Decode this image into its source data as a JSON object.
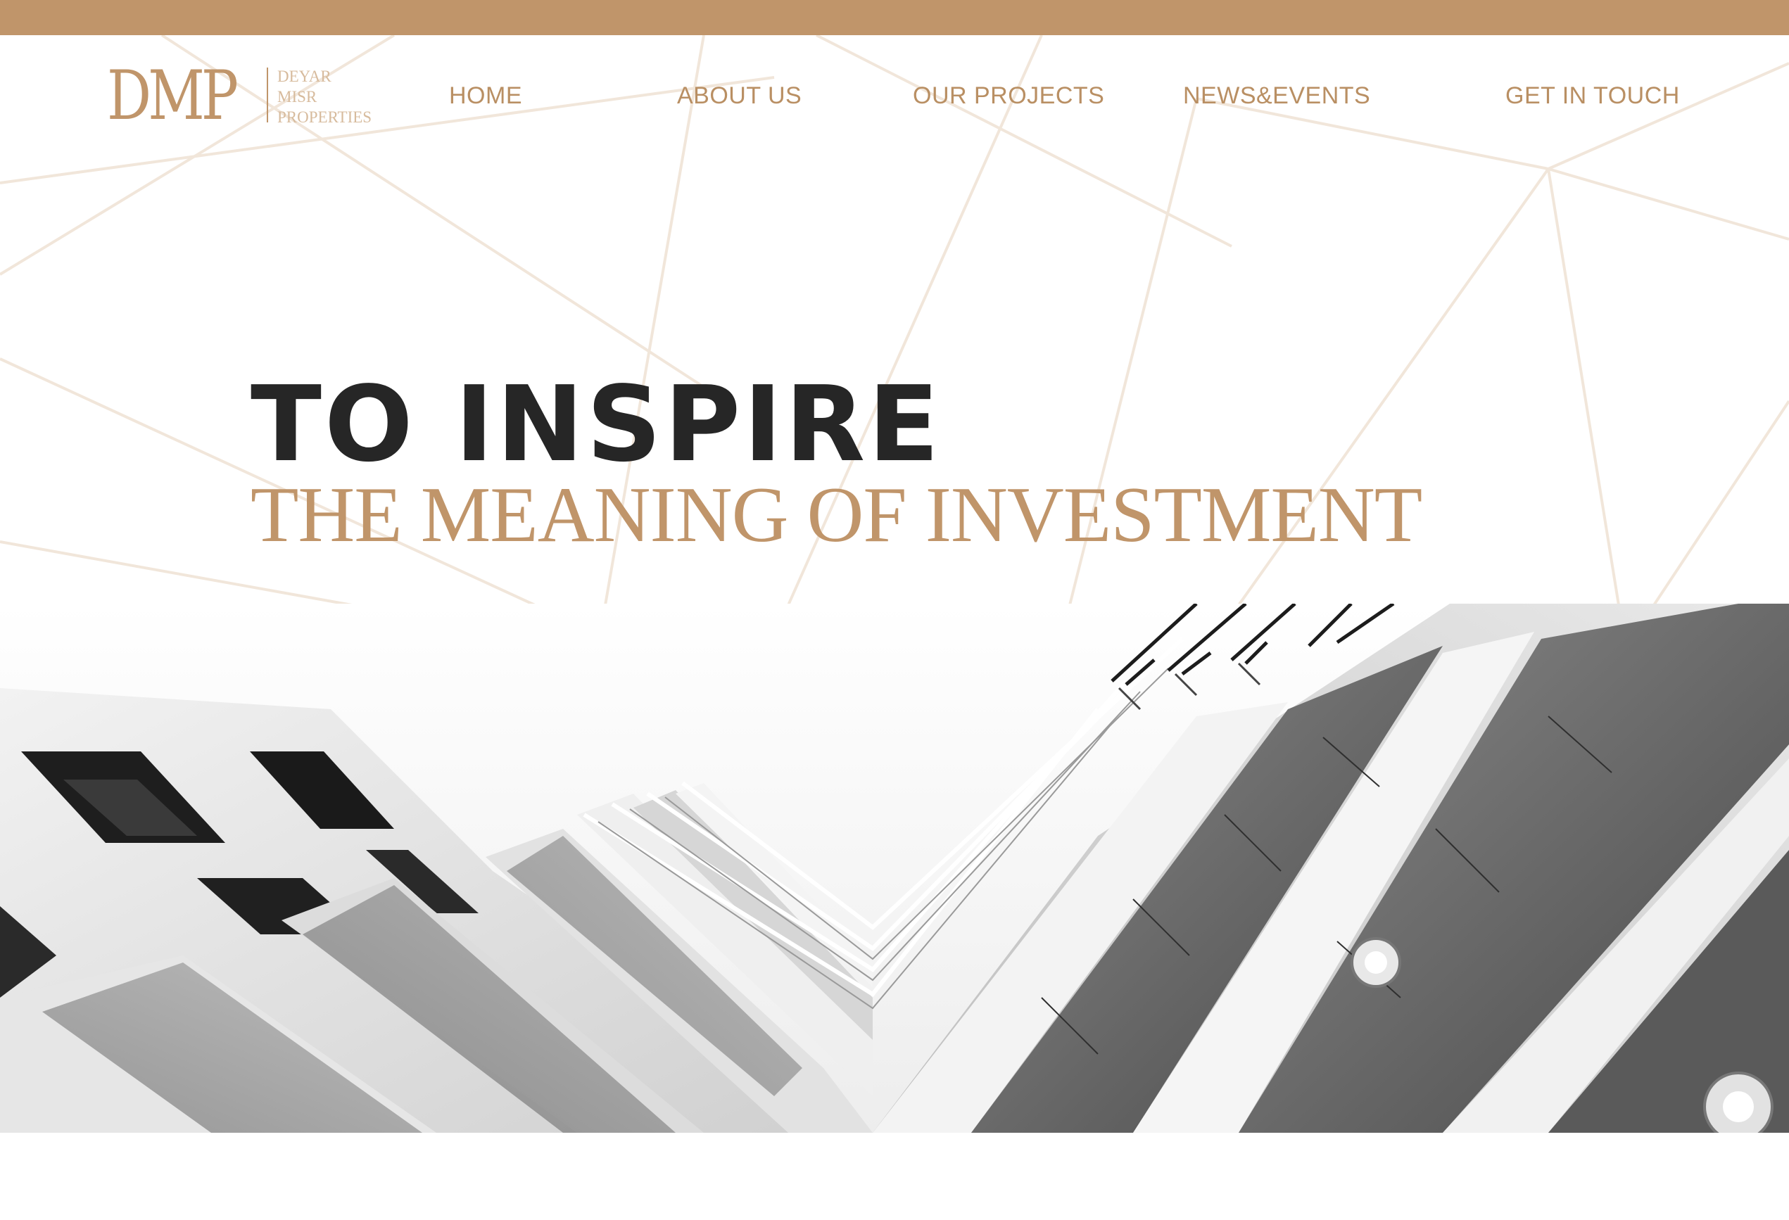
{
  "brand": {
    "mark": "DMP",
    "words": [
      "DEYAR",
      "MISR",
      "PROPERTIES"
    ],
    "accent_color": "#c0956a"
  },
  "nav": {
    "items": [
      {
        "label": "HOME"
      },
      {
        "label": "ABOUT US"
      },
      {
        "label": "OUR PROJECTS"
      },
      {
        "label": "NEWS&EVENTS"
      },
      {
        "label": "GET IN TOUCH"
      }
    ]
  },
  "hero": {
    "title": "TO INSPIRE",
    "subtitle": "THE MEANING OF INVESTMENT",
    "title_color": "#262626",
    "image_subject": "black-and-white modern building balconies"
  }
}
